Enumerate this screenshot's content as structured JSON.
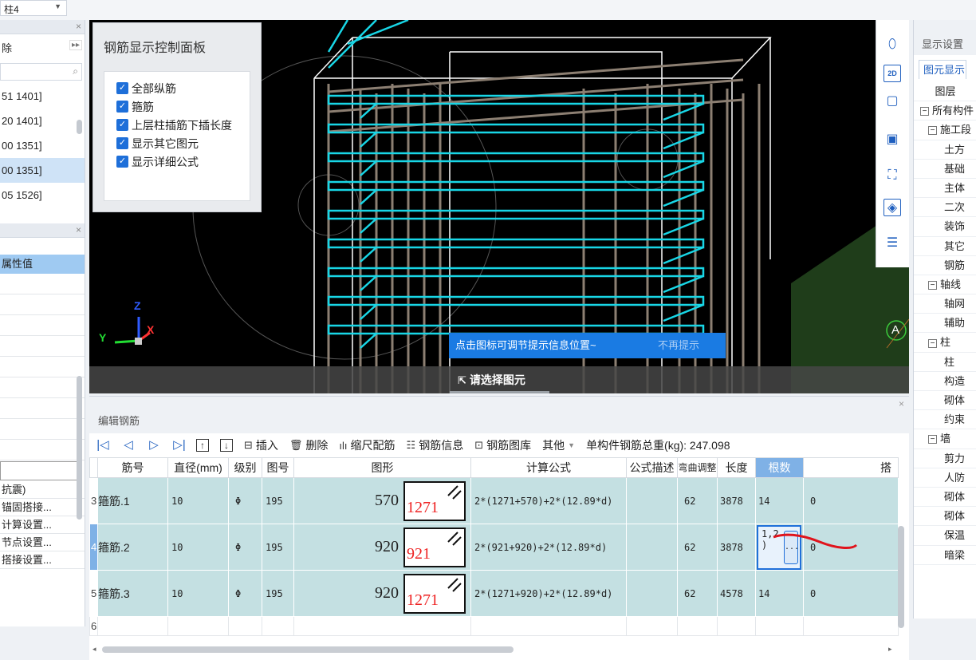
{
  "floor_select": {
    "value": "柱4"
  },
  "left_panel": {
    "toolbar_label": "除",
    "tree_items": [
      "51 1401]",
      "20 1401]",
      "00 1351]",
      "00 1351]",
      "05 1526]"
    ],
    "prop_header": "属性值",
    "prop_items": [
      "抗震)",
      "锚固搭接...",
      "计算设置...",
      "节点设置...",
      "搭接设置..."
    ]
  },
  "control_panel": {
    "title": "钢筋显示控制面板",
    "options": [
      "全部纵筋",
      "箍筋",
      "上层柱插筋下插长度",
      "显示其它图元",
      "显示详细公式"
    ]
  },
  "viewport": {
    "tip_text": "点击图标可调节提示信息位置~",
    "tip_dismiss": "不再提示",
    "status_text": "请选择图元",
    "axis_label_a": "A",
    "axis_z": "Z",
    "axis_y": "Y",
    "axis_x": "X"
  },
  "view_tools": [
    "orbit-icon",
    "2d-view-icon",
    "cube-front-icon",
    "cube-iso-icon",
    "zoom-extent-icon",
    "3d-box-icon",
    "view-settings-icon"
  ],
  "editor": {
    "title": "编辑钢筋",
    "toolbar": {
      "insert": "插入",
      "delete": "删除",
      "scale": "缩尺配筋",
      "info": "钢筋信息",
      "library": "钢筋图库",
      "other": "其他",
      "total_label": "单构件钢筋总重(kg):",
      "total_value": "247.098"
    },
    "columns": [
      "筋号",
      "直径(mm)",
      "级别",
      "图号",
      "图形",
      "计算公式",
      "公式描述",
      "弯曲调整",
      "长度",
      "根数",
      "搭"
    ],
    "rows": [
      {
        "num": "3",
        "name": "箍筋.1",
        "dia": "10",
        "grade": "Φ",
        "fig": "195",
        "shape_a": "570",
        "shape_b": "1271",
        "formula": "2*(1271+570)+2*(12.89*d)",
        "desc": "",
        "bend": "62",
        "length": "3878",
        "count": "14",
        "lap": "0"
      },
      {
        "num": "4",
        "name": "箍筋.2",
        "dia": "10",
        "grade": "Φ",
        "fig": "195",
        "shape_a": "920",
        "shape_b": "921",
        "formula": "2*(921+920)+2*(12.89*d)",
        "desc": "",
        "bend": "62",
        "length": "3878",
        "count": "1,2\n)",
        "lap": "0"
      },
      {
        "num": "5",
        "name": "箍筋.3",
        "dia": "10",
        "grade": "Φ",
        "fig": "195",
        "shape_a": "920",
        "shape_b": "1271",
        "formula": "2*(1271+920)+2*(12.89*d)",
        "desc": "",
        "bend": "62",
        "length": "4578",
        "count": "14",
        "lap": "0"
      },
      {
        "num": "6"
      }
    ],
    "count_edit_button": "..."
  },
  "right_panel": {
    "title": "显示设置",
    "tab": "图元显示",
    "items": [
      {
        "label": "图层",
        "level": "center"
      },
      {
        "label": "所有构件",
        "level": "l1",
        "toggle": "-"
      },
      {
        "label": "施工段",
        "level": "l2",
        "toggle": "-"
      },
      {
        "label": "土方",
        "level": "l3"
      },
      {
        "label": "基础",
        "level": "l3"
      },
      {
        "label": "主体",
        "level": "l3"
      },
      {
        "label": "二次",
        "level": "l3"
      },
      {
        "label": "装饰",
        "level": "l3"
      },
      {
        "label": "其它",
        "level": "l3"
      },
      {
        "label": "钢筋",
        "level": "l3"
      },
      {
        "label": "轴线",
        "level": "l2",
        "toggle": "-"
      },
      {
        "label": "轴网",
        "level": "l3"
      },
      {
        "label": "辅助",
        "level": "l3"
      },
      {
        "label": "柱",
        "level": "l2",
        "toggle": "-"
      },
      {
        "label": "柱",
        "level": "l3"
      },
      {
        "label": "构造",
        "level": "l3"
      },
      {
        "label": "砌体",
        "level": "l3"
      },
      {
        "label": "约束",
        "level": "l3"
      },
      {
        "label": "墙",
        "level": "l2",
        "toggle": "-"
      },
      {
        "label": "剪力",
        "level": "l3"
      },
      {
        "label": "人防",
        "level": "l3"
      },
      {
        "label": "砌体",
        "level": "l3"
      },
      {
        "label": "砌体",
        "level": "l3"
      },
      {
        "label": "保温",
        "level": "l3"
      },
      {
        "label": "暗梁",
        "level": "l3"
      }
    ]
  }
}
